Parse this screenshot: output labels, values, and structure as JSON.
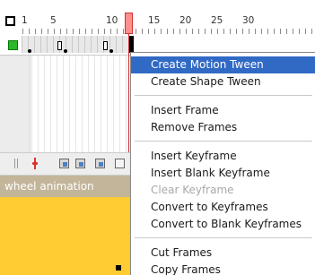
{
  "ruler": {
    "frame_numbers": [
      "1",
      "5",
      "10",
      "15",
      "20",
      "25",
      "30"
    ],
    "current_frame": 13
  },
  "layer": {
    "color": "#2ab82a"
  },
  "toolbar": {
    "icons": [
      "scroll-bar-icon",
      "center-frame-icon",
      "onion-skin-icon",
      "onion-outline-icon",
      "edit-multiple-frames-icon",
      "modify-markers-icon"
    ]
  },
  "scene": {
    "title": "wheel animation",
    "bar_color": "#c2b59a",
    "stage_color": "#ffcc33"
  },
  "context_menu": {
    "highlight_color": "#316ac5",
    "items": [
      {
        "label": "Create Motion Tween",
        "state": "highlighted"
      },
      {
        "label": "Create Shape Tween",
        "state": "enabled"
      },
      {
        "label": "Insert Frame",
        "state": "enabled"
      },
      {
        "label": "Remove Frames",
        "state": "enabled"
      },
      {
        "label": "Insert Keyframe",
        "state": "enabled"
      },
      {
        "label": "Insert Blank Keyframe",
        "state": "enabled"
      },
      {
        "label": "Clear Keyframe",
        "state": "disabled"
      },
      {
        "label": "Convert to Keyframes",
        "state": "enabled"
      },
      {
        "label": "Convert to Blank Keyframes",
        "state": "enabled"
      },
      {
        "label": "Cut Frames",
        "state": "enabled"
      },
      {
        "label": "Copy Frames",
        "state": "enabled"
      }
    ]
  }
}
